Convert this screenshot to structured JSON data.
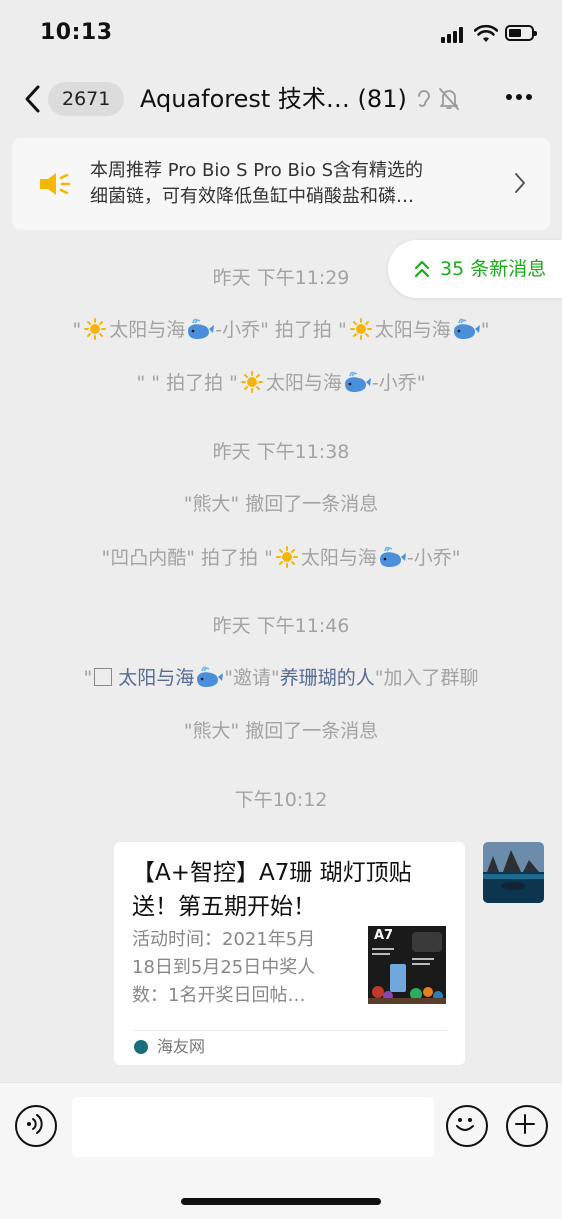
{
  "status_bar": {
    "time": "10:13"
  },
  "header": {
    "unread_count": "2671",
    "title": "Aquaforest 技术… (81)"
  },
  "notice": {
    "line1": "本周推荐  Pro Bio S Pro Bio S含有精选的",
    "line2": "细菌链，可有效降低鱼缸中硝酸盐和磷…"
  },
  "new_messages": {
    "label": "35 条新消息"
  },
  "system_messages": {
    "ts1": "昨天 下午11:29",
    "pat1_a": "\"",
    "pat1_b": "太阳与海",
    "pat1_c": "-小乔\" 拍了拍 \"",
    "pat1_d": "太阳与海",
    "pat1_e": "\"",
    "pat2_a": "\"  \" 拍了拍 \"",
    "pat2_b": "太阳与海",
    "pat2_c": "-小乔\"",
    "ts2": "昨天 下午11:38",
    "recall1": "\"熊大\" 撤回了一条消息",
    "pat3_a": "\"凹凸内酷\" 拍了拍 \"",
    "pat3_b": "太阳与海",
    "pat3_c": "-小乔\"",
    "ts3": "昨天 下午11:46",
    "invite_a": "\"",
    "invite_inviter": "太阳与海",
    "invite_b": "\"邀请\"",
    "invite_invitee": "养珊瑚的人",
    "invite_c": "\"加入了群聊",
    "recall2": "\"熊大\" 撤回了一条消息",
    "ts4": "下午10:12"
  },
  "card": {
    "title": "【A+智控】A7珊 瑚灯顶贴送！第五期开始！",
    "desc_line1": "活动时间：2021年5月",
    "desc_line2": "18日到5月25日中奖人",
    "desc_line3": "数：1名开奖日回帖…",
    "thumb_text": "A7",
    "source": "海友网"
  },
  "colors": {
    "background": "#ededed",
    "link": "#576b95",
    "accent_green": "#1aad19",
    "system_text": "#a3a3a3",
    "speaker": "#f5b800"
  }
}
